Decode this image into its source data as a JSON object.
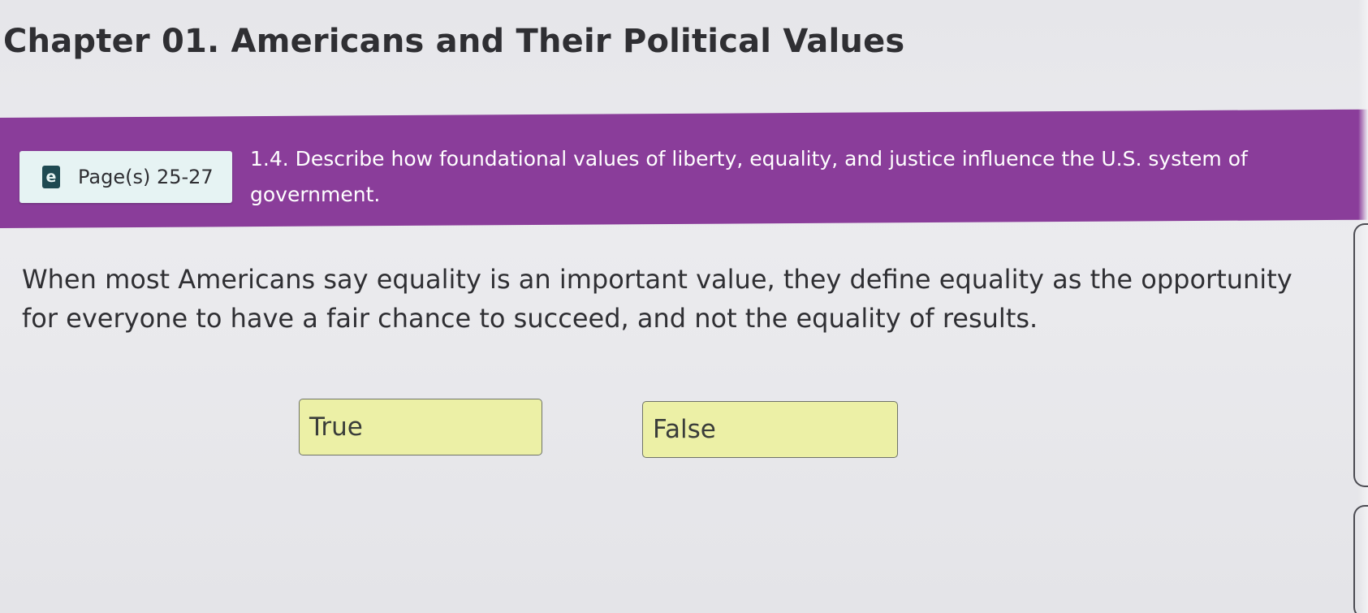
{
  "chapter": {
    "title": "Chapter 01. Americans and Their Political Values"
  },
  "objective": {
    "page_ref_icon": "ebook-icon",
    "page_ref_icon_glyph": "e",
    "page_ref_label": "Page(s) 25-27",
    "text": "1.4. Describe how foundational values of liberty, equality, and justice influence the U.S. system of government.",
    "banner_color": "#8a3d9a"
  },
  "question": {
    "text": "When most Americans say equality is an important value, they define equality as the opportunity for everyone to have a fair chance to succeed, and not the equality of results."
  },
  "answers": [
    {
      "label": "True"
    },
    {
      "label": "False"
    }
  ],
  "colors": {
    "answer_fill": "#ecf0a6",
    "page_ref_fill": "#e6f3f3"
  }
}
